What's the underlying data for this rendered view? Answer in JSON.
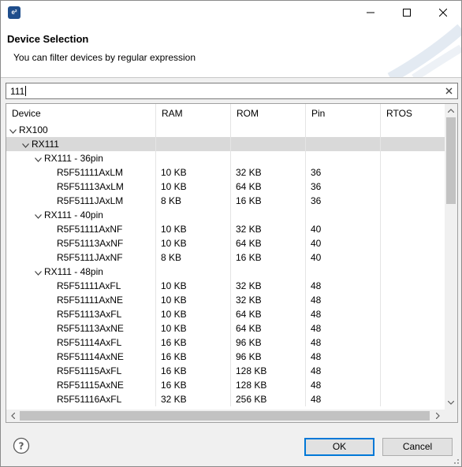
{
  "window": {
    "app_icon": "e²",
    "icons": {
      "minimize": "minimize-icon",
      "maximize": "maximize-icon",
      "close": "close-icon"
    }
  },
  "header": {
    "title": "Device Selection",
    "subtitle": "You can filter devices by regular expression"
  },
  "search": {
    "value": "111",
    "clear_icon": "clear-icon"
  },
  "table": {
    "columns": [
      "Device",
      "RAM",
      "ROM",
      "Pin",
      "RTOS"
    ],
    "rows": [
      {
        "level": 0,
        "expanded": true,
        "device": "RX100",
        "ram": "",
        "rom": "",
        "pin": "",
        "rtos": ""
      },
      {
        "level": 1,
        "expanded": true,
        "selected": true,
        "device": "RX111",
        "ram": "",
        "rom": "",
        "pin": "",
        "rtos": ""
      },
      {
        "level": 2,
        "expanded": true,
        "device": "RX111 - 36pin",
        "ram": "",
        "rom": "",
        "pin": "",
        "rtos": ""
      },
      {
        "level": 3,
        "device": "R5F51111AxLM",
        "ram": "10 KB",
        "rom": "32 KB",
        "pin": "36",
        "rtos": ""
      },
      {
        "level": 3,
        "device": "R5F51113AxLM",
        "ram": "10 KB",
        "rom": "64 KB",
        "pin": "36",
        "rtos": ""
      },
      {
        "level": 3,
        "device": "R5F5111JAxLM",
        "ram": "8 KB",
        "rom": "16 KB",
        "pin": "36",
        "rtos": ""
      },
      {
        "level": 2,
        "expanded": true,
        "device": "RX111 - 40pin",
        "ram": "",
        "rom": "",
        "pin": "",
        "rtos": ""
      },
      {
        "level": 3,
        "device": "R5F51111AxNF",
        "ram": "10 KB",
        "rom": "32 KB",
        "pin": "40",
        "rtos": ""
      },
      {
        "level": 3,
        "device": "R5F51113AxNF",
        "ram": "10 KB",
        "rom": "64 KB",
        "pin": "40",
        "rtos": ""
      },
      {
        "level": 3,
        "device": "R5F5111JAxNF",
        "ram": "8 KB",
        "rom": "16 KB",
        "pin": "40",
        "rtos": ""
      },
      {
        "level": 2,
        "expanded": true,
        "device": "RX111 - 48pin",
        "ram": "",
        "rom": "",
        "pin": "",
        "rtos": ""
      },
      {
        "level": 3,
        "device": "R5F51111AxFL",
        "ram": "10 KB",
        "rom": "32 KB",
        "pin": "48",
        "rtos": ""
      },
      {
        "level": 3,
        "device": "R5F51111AxNE",
        "ram": "10 KB",
        "rom": "32 KB",
        "pin": "48",
        "rtos": ""
      },
      {
        "level": 3,
        "device": "R5F51113AxFL",
        "ram": "10 KB",
        "rom": "64 KB",
        "pin": "48",
        "rtos": ""
      },
      {
        "level": 3,
        "device": "R5F51113AxNE",
        "ram": "10 KB",
        "rom": "64 KB",
        "pin": "48",
        "rtos": ""
      },
      {
        "level": 3,
        "device": "R5F51114AxFL",
        "ram": "16 KB",
        "rom": "96 KB",
        "pin": "48",
        "rtos": ""
      },
      {
        "level": 3,
        "device": "R5F51114AxNE",
        "ram": "16 KB",
        "rom": "96 KB",
        "pin": "48",
        "rtos": ""
      },
      {
        "level": 3,
        "device": "R5F51115AxFL",
        "ram": "16 KB",
        "rom": "128 KB",
        "pin": "48",
        "rtos": ""
      },
      {
        "level": 3,
        "device": "R5F51115AxNE",
        "ram": "16 KB",
        "rom": "128 KB",
        "pin": "48",
        "rtos": ""
      },
      {
        "level": 3,
        "device": "R5F51116AxFL",
        "ram": "32 KB",
        "rom": "256 KB",
        "pin": "48",
        "rtos": ""
      }
    ]
  },
  "footer": {
    "help_icon": "help-icon",
    "ok_label": "OK",
    "cancel_label": "Cancel"
  },
  "colors": {
    "accent": "#0078d7",
    "selected_row": "#d9d9d9",
    "header_bg": "#ffffff",
    "dialog_bg": "#f0f0f0"
  }
}
